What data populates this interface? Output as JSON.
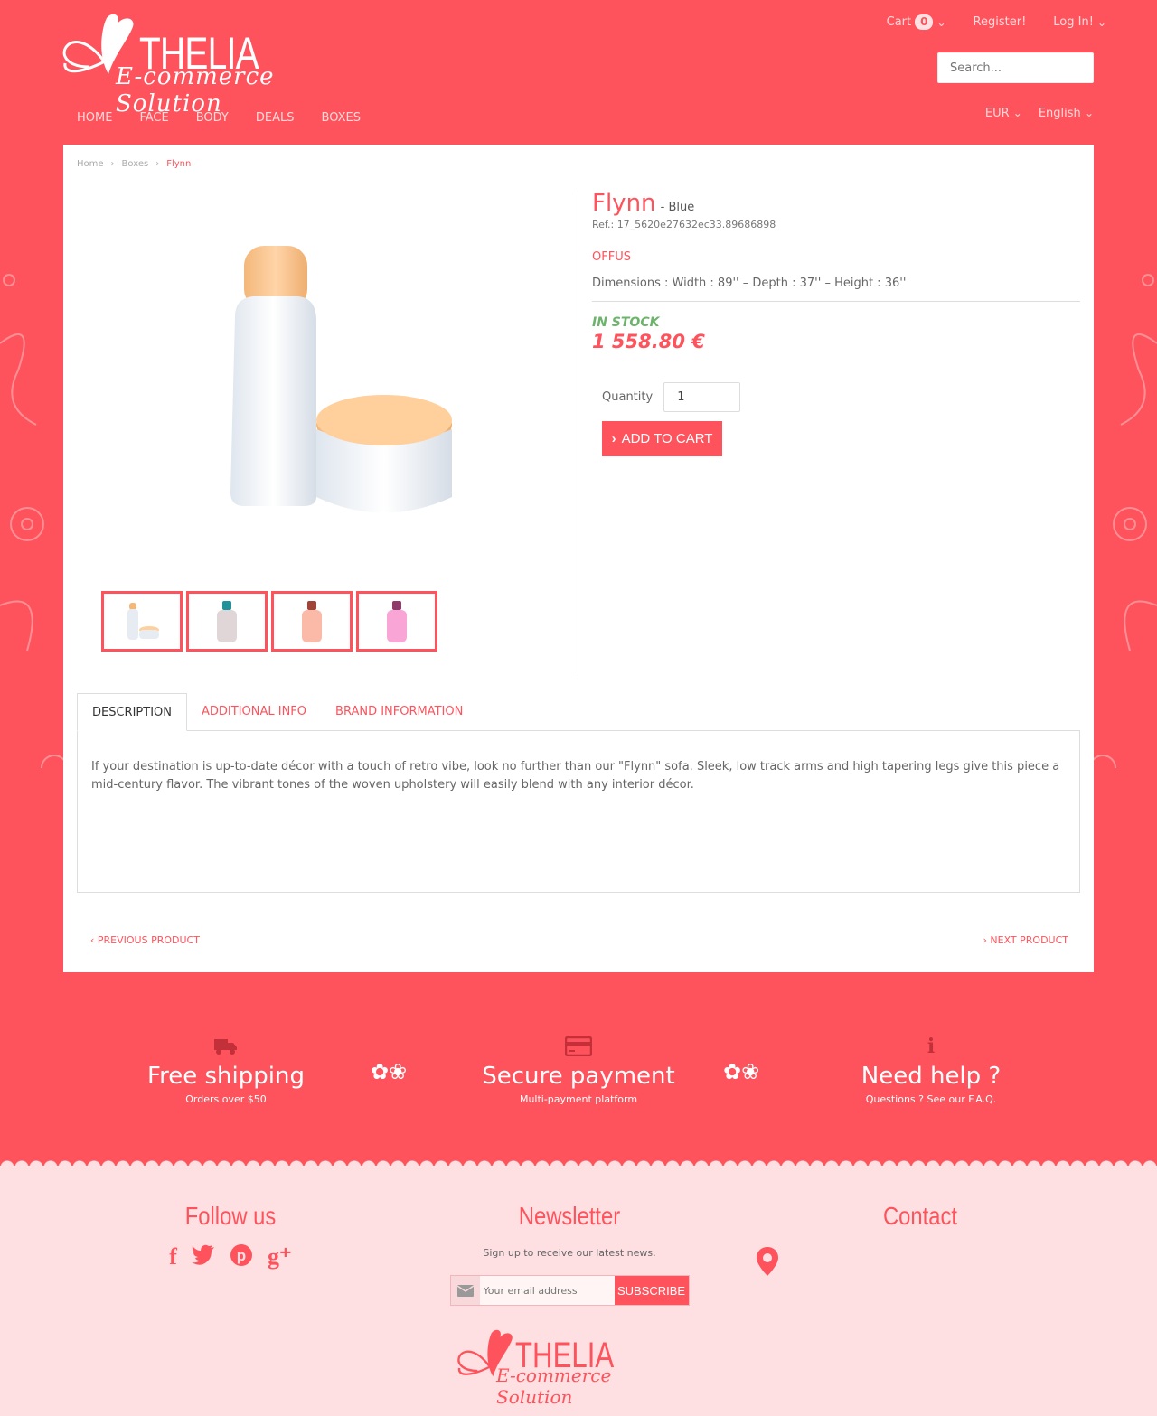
{
  "brand": {
    "name": "THELIA",
    "tagline": "E-commerce Solution"
  },
  "header": {
    "cart_label": "Cart",
    "cart_count": "0",
    "register": "Register!",
    "login": "Log In!",
    "search_placeholder": "Search...",
    "currency": "EUR",
    "language": "English",
    "nav": [
      "HOME",
      "FACE",
      "BODY",
      "DEALS",
      "BOXES"
    ]
  },
  "breadcrumb": [
    "Home",
    "Boxes",
    "Flynn"
  ],
  "product": {
    "name": "Flynn",
    "variant": "- Blue",
    "ref": "Ref.: 17_5620e27632ec33.89686898",
    "brand": "OFFUS",
    "dimensions": "Dimensions : Width : 89'' – Depth : 37'' – Height : 36''",
    "stock": "IN STOCK",
    "price": "1 558.80 €",
    "quantity_label": "Quantity",
    "quantity_value": "1",
    "add_to_cart": "ADD TO CART"
  },
  "tabs": [
    "DESCRIPTION",
    "ADDITIONAL INFO",
    "BRAND INFORMATION"
  ],
  "description": "If your destination is up-to-date décor with a touch of retro vibe, look no further than our \"Flynn\" sofa. Sleek, low track arms and high tapering legs give this piece a mid-century flavor. The vibrant tones of the woven upholstery will easily blend with any interior décor.",
  "pager": {
    "prev": "PREVIOUS PRODUCT",
    "next": "NEXT PRODUCT"
  },
  "features": [
    {
      "title": "Free shipping",
      "sub": "Orders over $50",
      "icon": "truck-icon"
    },
    {
      "title": "Secure payment",
      "sub": "Multi-payment platform",
      "icon": "credit-card-icon"
    },
    {
      "title": "Need help ?",
      "sub": "Questions ? See our F.A.Q.",
      "icon": "info-icon"
    }
  ],
  "footer": {
    "follow_title": "Follow us",
    "newsletter_title": "Newsletter",
    "newsletter_text": "Sign up to receive our latest news.",
    "email_placeholder": "Your email address",
    "subscribe": "SUBSCRIBE",
    "contact_title": "Contact"
  },
  "colors": {
    "accent": "#fe535c",
    "footer_bg": "#fee0e2",
    "stock": "#6cb36c"
  }
}
